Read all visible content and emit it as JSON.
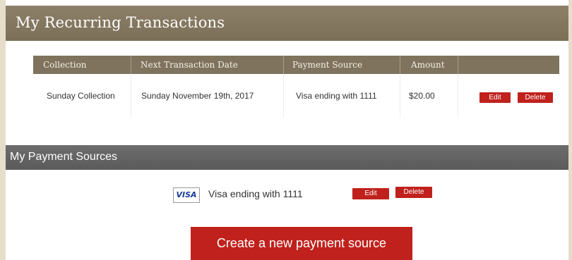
{
  "recurring": {
    "title": "My Recurring Transactions",
    "columns": [
      "Collection",
      "Next Transaction Date",
      "Payment Source",
      "Amount"
    ],
    "rows": [
      {
        "collection": "Sunday Collection",
        "next_date": "Sunday November 19th, 2017",
        "payment_source": "Visa ending with 1111",
        "amount": "$20.00",
        "edit_label": "Edit",
        "delete_label": "Delete"
      }
    ]
  },
  "payment_sources": {
    "title": "My Payment Sources",
    "items": [
      {
        "card_brand": "VISA",
        "label": "Visa ending with 1111",
        "edit_label": "Edit",
        "delete_label": "Delete"
      }
    ],
    "create_label": "Create a new payment source"
  },
  "colors": {
    "header_brown": "#7f735d",
    "section_gray": "#5f5f5f",
    "button_red": "#c0211c",
    "visa_blue": "#1a3c9a"
  }
}
